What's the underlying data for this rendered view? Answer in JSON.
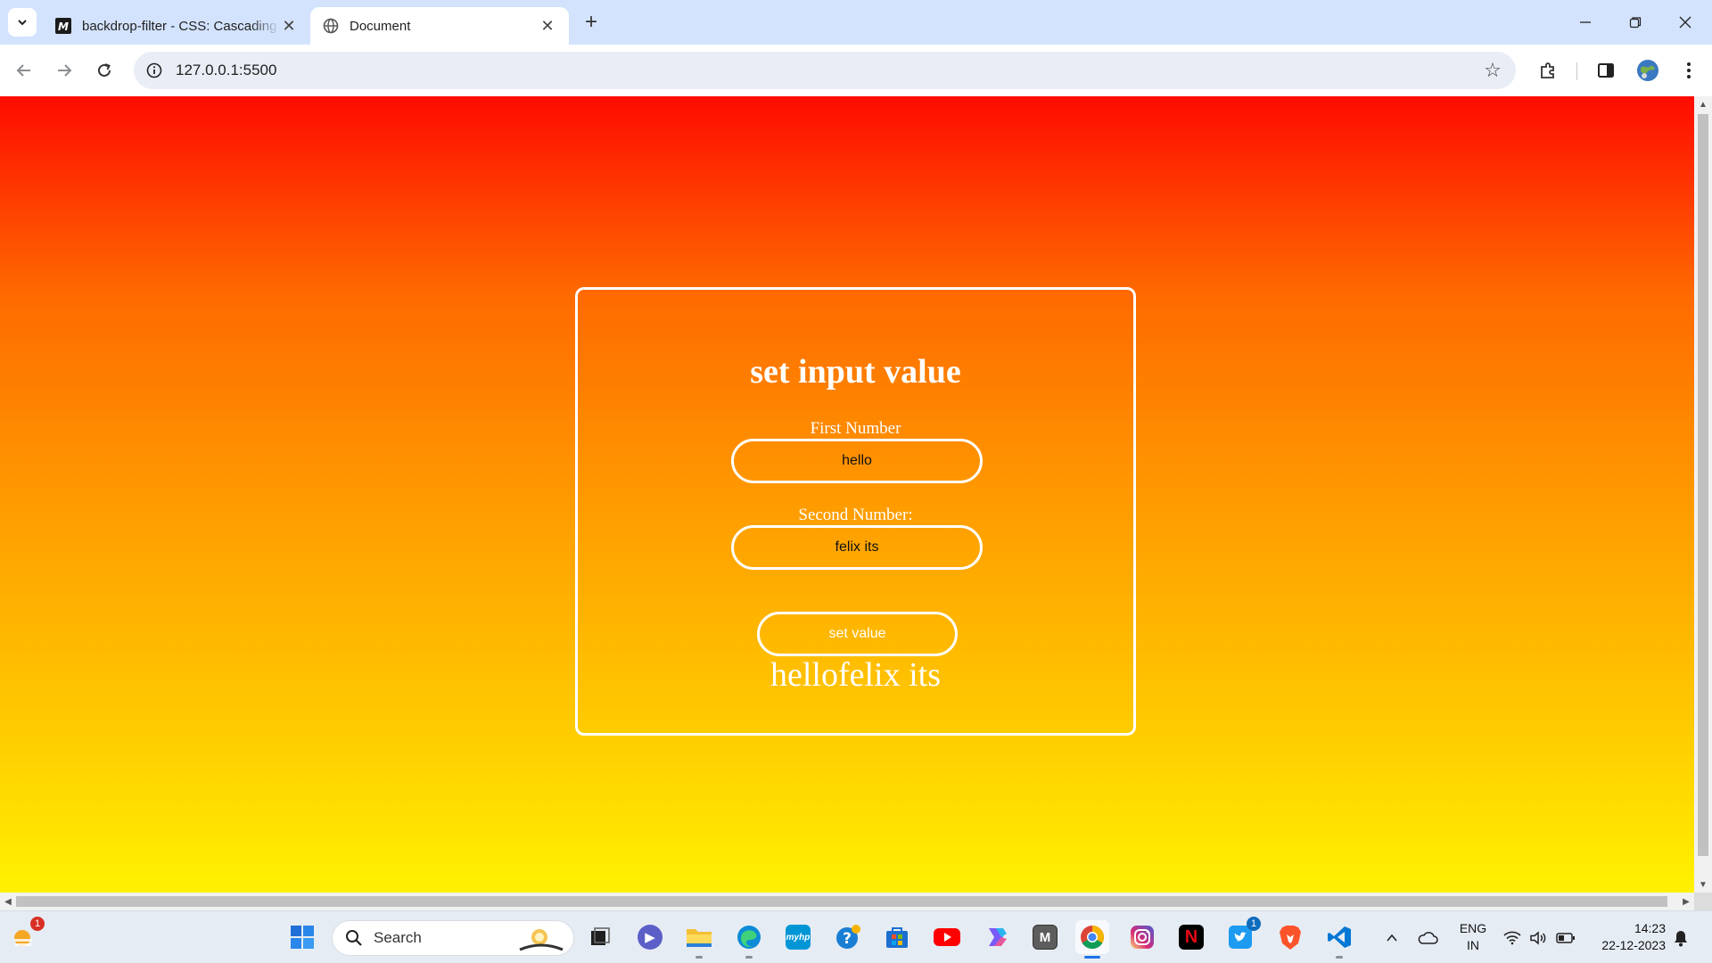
{
  "browser": {
    "tabs": [
      {
        "title": "backdrop-filter - CSS: Cascading Style Sheets | MDN",
        "favicon": "mdn-icon",
        "active": false
      },
      {
        "title": "Document",
        "favicon": "globe-icon",
        "active": true
      }
    ],
    "url": "127.0.0.1:5500",
    "favicon_letter": "M"
  },
  "page": {
    "heading": "set input value",
    "first_label": "First Number",
    "first_value": "hello",
    "second_label": "Second Number:",
    "second_value": "felix its",
    "button_label": "set value",
    "result": "hellofelix its"
  },
  "taskbar": {
    "search_label": "Search",
    "widgets_badge": "1",
    "twitter_badge": "1",
    "lang_line1": "ENG",
    "lang_line2": "IN",
    "time": "14:23",
    "date": "22-12-2023",
    "mylogo_text": "myhp",
    "m_app_letter": "M",
    "netflix_letter": "N"
  },
  "colors": {
    "gradient_top": "#fe0b00",
    "gradient_bottom": "#fff200",
    "tabbar": "#d3e3fd"
  }
}
